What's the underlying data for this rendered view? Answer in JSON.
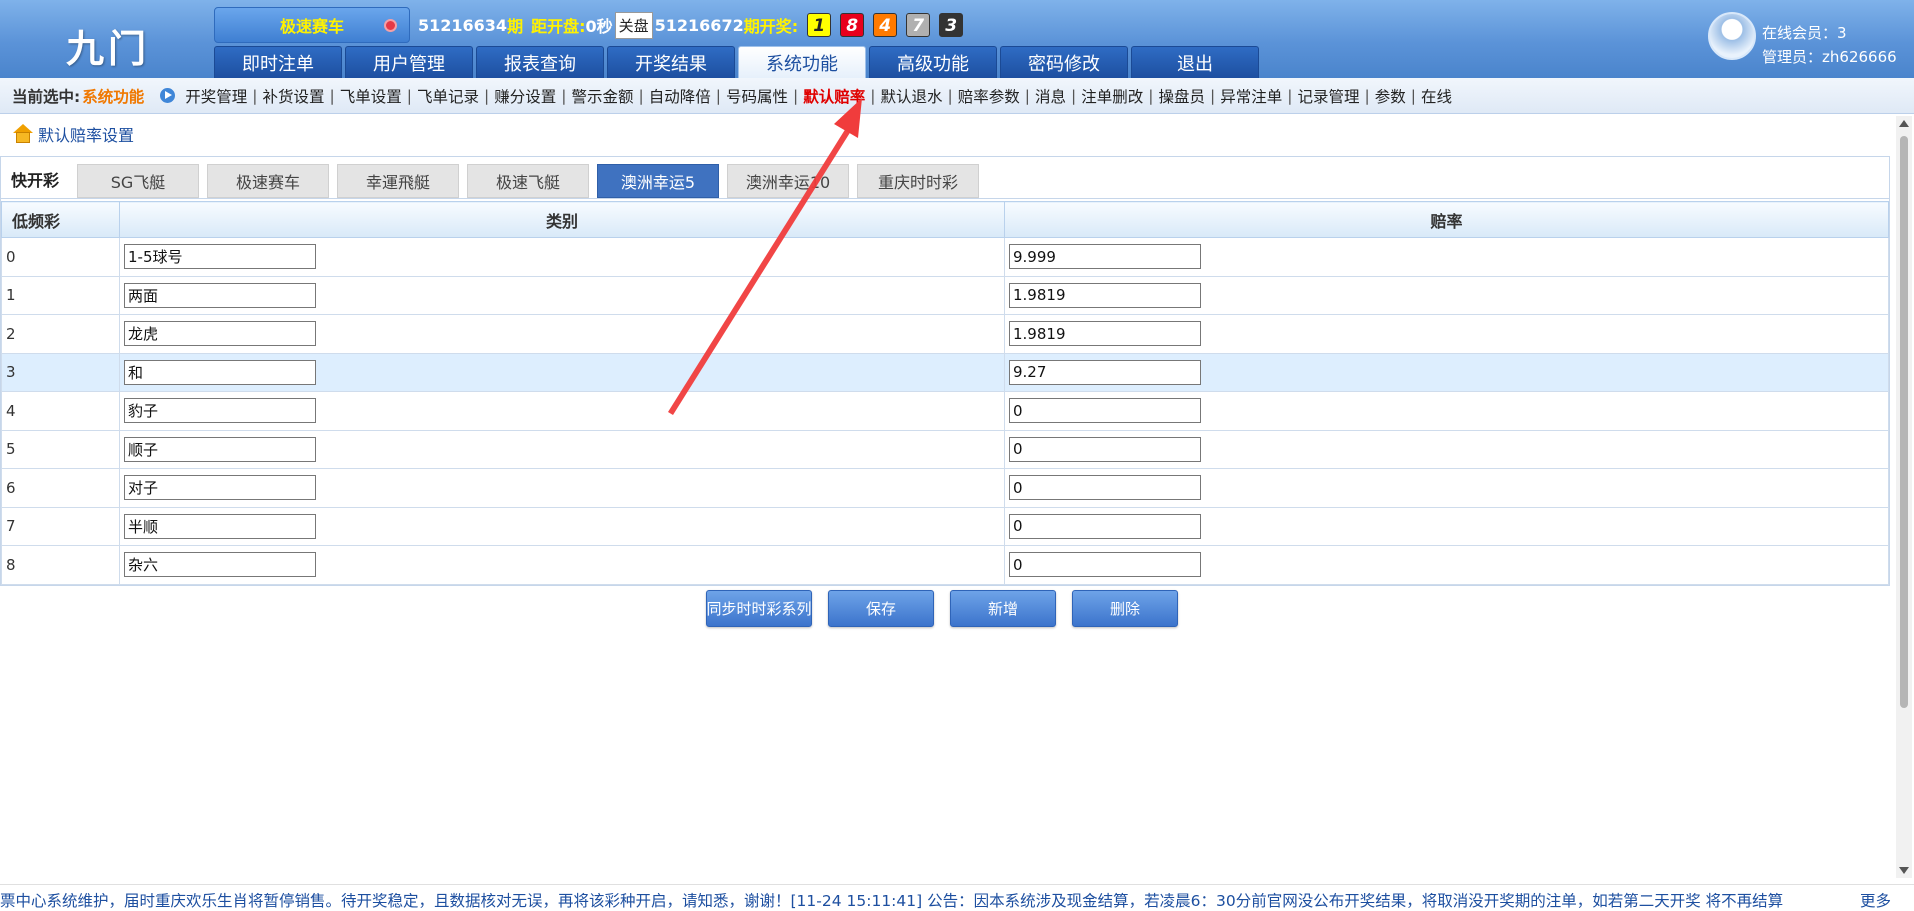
{
  "brand": {
    "logo": "九门"
  },
  "header": {
    "game_name": "极速赛车",
    "period_current": "51216634",
    "period_suffix": "期",
    "countdown_label": "距开盘:",
    "countdown_value": "0秒",
    "close_badge": "关盘",
    "period_draw": "51216672",
    "draw_label": "期开奖:",
    "balls": [
      "1",
      "8",
      "4",
      "7",
      "3"
    ]
  },
  "nav": {
    "tabs": [
      "即时注单",
      "用户管理",
      "报表查询",
      "开奖结果",
      "系统功能",
      "高级功能",
      "密码修改",
      "退出"
    ],
    "active_index": 4
  },
  "user": {
    "online_label": "在线会员：",
    "online_value": "3",
    "admin_label": "管理员：",
    "admin_value": "zh626666"
  },
  "subbar": {
    "current_label": "当前选中:",
    "current_value": "系统功能",
    "items": [
      "开奖管理",
      "补货设置",
      "飞单设置",
      "飞单记录",
      "赚分设置",
      "警示金额",
      "自动降倍",
      "号码属性",
      "默认赔率",
      "默认退水",
      "赔率参数",
      "消息",
      "注单删改",
      "操盘员",
      "异常注单",
      "记录管理",
      "参数",
      "在线"
    ],
    "active_index": 8
  },
  "page": {
    "title": "默认赔率设置"
  },
  "lottery_tabs": {
    "label": "快开彩",
    "tabs": [
      "SG飞艇",
      "极速赛车",
      "幸運飛艇",
      "极速飞艇",
      "澳洲幸运5",
      "澳洲幸运10",
      "重庆时时彩"
    ],
    "active_index": 4
  },
  "table": {
    "headers": [
      "低频彩",
      "类别",
      "赔率"
    ],
    "rows": [
      {
        "idx": "0",
        "category": "1-5球号",
        "odds": "9.999"
      },
      {
        "idx": "1",
        "category": "两面",
        "odds": "1.9819"
      },
      {
        "idx": "2",
        "category": "龙虎",
        "odds": "1.9819"
      },
      {
        "idx": "3",
        "category": "和",
        "odds": "9.27"
      },
      {
        "idx": "4",
        "category": "豹子",
        "odds": "0"
      },
      {
        "idx": "5",
        "category": "顺子",
        "odds": "0"
      },
      {
        "idx": "6",
        "category": "对子",
        "odds": "0"
      },
      {
        "idx": "7",
        "category": "半顺",
        "odds": "0"
      },
      {
        "idx": "8",
        "category": "杂六",
        "odds": "0"
      }
    ],
    "highlight_row": 3
  },
  "buttons": {
    "sync": "同步时时彩系列",
    "save": "保存",
    "add": "新增",
    "delete": "删除"
  },
  "marquee": {
    "text": "票中心系统维护，届时重庆欢乐生肖将暂停销售。待开奖稳定，且数据核对无误，再将该彩种开启，请知悉，谢谢！[11-24 15:11:41] 公告：因本系统涉及现金结算，若凌晨6：30分前官网没公布开奖结果，将取消没开奖期的注单，如若第二天开奖 将不再结算",
    "more": "更多"
  },
  "colors": {
    "accent": "#3f72c0",
    "active_menu": "#e00000",
    "annotation_arrow": "#f03c3c"
  }
}
